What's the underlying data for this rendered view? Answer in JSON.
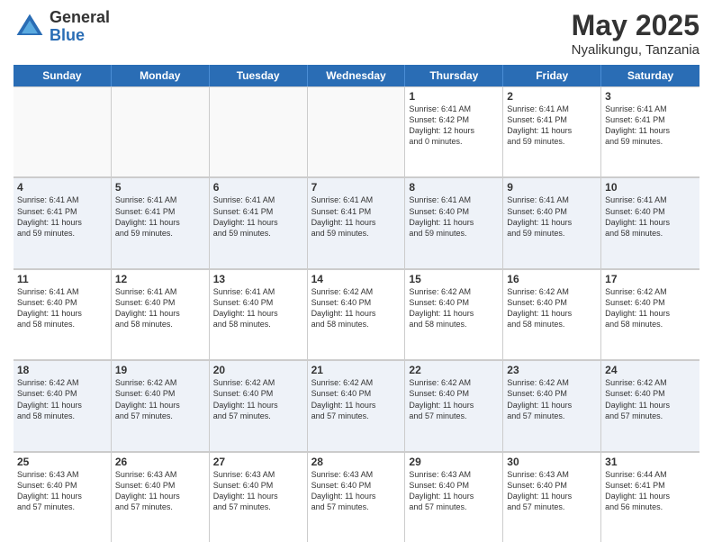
{
  "header": {
    "logo_general": "General",
    "logo_blue": "Blue",
    "title": "May 2025",
    "subtitle": "Nyalikungu, Tanzania"
  },
  "days": [
    "Sunday",
    "Monday",
    "Tuesday",
    "Wednesday",
    "Thursday",
    "Friday",
    "Saturday"
  ],
  "rows": [
    [
      {
        "num": "",
        "lines": [],
        "empty": true
      },
      {
        "num": "",
        "lines": [],
        "empty": true
      },
      {
        "num": "",
        "lines": [],
        "empty": true
      },
      {
        "num": "",
        "lines": [],
        "empty": true
      },
      {
        "num": "1",
        "lines": [
          "Sunrise: 6:41 AM",
          "Sunset: 6:42 PM",
          "Daylight: 12 hours",
          "and 0 minutes."
        ]
      },
      {
        "num": "2",
        "lines": [
          "Sunrise: 6:41 AM",
          "Sunset: 6:41 PM",
          "Daylight: 11 hours",
          "and 59 minutes."
        ]
      },
      {
        "num": "3",
        "lines": [
          "Sunrise: 6:41 AM",
          "Sunset: 6:41 PM",
          "Daylight: 11 hours",
          "and 59 minutes."
        ]
      }
    ],
    [
      {
        "num": "4",
        "lines": [
          "Sunrise: 6:41 AM",
          "Sunset: 6:41 PM",
          "Daylight: 11 hours",
          "and 59 minutes."
        ]
      },
      {
        "num": "5",
        "lines": [
          "Sunrise: 6:41 AM",
          "Sunset: 6:41 PM",
          "Daylight: 11 hours",
          "and 59 minutes."
        ]
      },
      {
        "num": "6",
        "lines": [
          "Sunrise: 6:41 AM",
          "Sunset: 6:41 PM",
          "Daylight: 11 hours",
          "and 59 minutes."
        ]
      },
      {
        "num": "7",
        "lines": [
          "Sunrise: 6:41 AM",
          "Sunset: 6:41 PM",
          "Daylight: 11 hours",
          "and 59 minutes."
        ]
      },
      {
        "num": "8",
        "lines": [
          "Sunrise: 6:41 AM",
          "Sunset: 6:40 PM",
          "Daylight: 11 hours",
          "and 59 minutes."
        ]
      },
      {
        "num": "9",
        "lines": [
          "Sunrise: 6:41 AM",
          "Sunset: 6:40 PM",
          "Daylight: 11 hours",
          "and 59 minutes."
        ]
      },
      {
        "num": "10",
        "lines": [
          "Sunrise: 6:41 AM",
          "Sunset: 6:40 PM",
          "Daylight: 11 hours",
          "and 58 minutes."
        ]
      }
    ],
    [
      {
        "num": "11",
        "lines": [
          "Sunrise: 6:41 AM",
          "Sunset: 6:40 PM",
          "Daylight: 11 hours",
          "and 58 minutes."
        ]
      },
      {
        "num": "12",
        "lines": [
          "Sunrise: 6:41 AM",
          "Sunset: 6:40 PM",
          "Daylight: 11 hours",
          "and 58 minutes."
        ]
      },
      {
        "num": "13",
        "lines": [
          "Sunrise: 6:41 AM",
          "Sunset: 6:40 PM",
          "Daylight: 11 hours",
          "and 58 minutes."
        ]
      },
      {
        "num": "14",
        "lines": [
          "Sunrise: 6:42 AM",
          "Sunset: 6:40 PM",
          "Daylight: 11 hours",
          "and 58 minutes."
        ]
      },
      {
        "num": "15",
        "lines": [
          "Sunrise: 6:42 AM",
          "Sunset: 6:40 PM",
          "Daylight: 11 hours",
          "and 58 minutes."
        ]
      },
      {
        "num": "16",
        "lines": [
          "Sunrise: 6:42 AM",
          "Sunset: 6:40 PM",
          "Daylight: 11 hours",
          "and 58 minutes."
        ]
      },
      {
        "num": "17",
        "lines": [
          "Sunrise: 6:42 AM",
          "Sunset: 6:40 PM",
          "Daylight: 11 hours",
          "and 58 minutes."
        ]
      }
    ],
    [
      {
        "num": "18",
        "lines": [
          "Sunrise: 6:42 AM",
          "Sunset: 6:40 PM",
          "Daylight: 11 hours",
          "and 58 minutes."
        ]
      },
      {
        "num": "19",
        "lines": [
          "Sunrise: 6:42 AM",
          "Sunset: 6:40 PM",
          "Daylight: 11 hours",
          "and 57 minutes."
        ]
      },
      {
        "num": "20",
        "lines": [
          "Sunrise: 6:42 AM",
          "Sunset: 6:40 PM",
          "Daylight: 11 hours",
          "and 57 minutes."
        ]
      },
      {
        "num": "21",
        "lines": [
          "Sunrise: 6:42 AM",
          "Sunset: 6:40 PM",
          "Daylight: 11 hours",
          "and 57 minutes."
        ]
      },
      {
        "num": "22",
        "lines": [
          "Sunrise: 6:42 AM",
          "Sunset: 6:40 PM",
          "Daylight: 11 hours",
          "and 57 minutes."
        ]
      },
      {
        "num": "23",
        "lines": [
          "Sunrise: 6:42 AM",
          "Sunset: 6:40 PM",
          "Daylight: 11 hours",
          "and 57 minutes."
        ]
      },
      {
        "num": "24",
        "lines": [
          "Sunrise: 6:42 AM",
          "Sunset: 6:40 PM",
          "Daylight: 11 hours",
          "and 57 minutes."
        ]
      }
    ],
    [
      {
        "num": "25",
        "lines": [
          "Sunrise: 6:43 AM",
          "Sunset: 6:40 PM",
          "Daylight: 11 hours",
          "and 57 minutes."
        ]
      },
      {
        "num": "26",
        "lines": [
          "Sunrise: 6:43 AM",
          "Sunset: 6:40 PM",
          "Daylight: 11 hours",
          "and 57 minutes."
        ]
      },
      {
        "num": "27",
        "lines": [
          "Sunrise: 6:43 AM",
          "Sunset: 6:40 PM",
          "Daylight: 11 hours",
          "and 57 minutes."
        ]
      },
      {
        "num": "28",
        "lines": [
          "Sunrise: 6:43 AM",
          "Sunset: 6:40 PM",
          "Daylight: 11 hours",
          "and 57 minutes."
        ]
      },
      {
        "num": "29",
        "lines": [
          "Sunrise: 6:43 AM",
          "Sunset: 6:40 PM",
          "Daylight: 11 hours",
          "and 57 minutes."
        ]
      },
      {
        "num": "30",
        "lines": [
          "Sunrise: 6:43 AM",
          "Sunset: 6:40 PM",
          "Daylight: 11 hours",
          "and 57 minutes."
        ]
      },
      {
        "num": "31",
        "lines": [
          "Sunrise: 6:44 AM",
          "Sunset: 6:41 PM",
          "Daylight: 11 hours",
          "and 56 minutes."
        ]
      }
    ]
  ]
}
